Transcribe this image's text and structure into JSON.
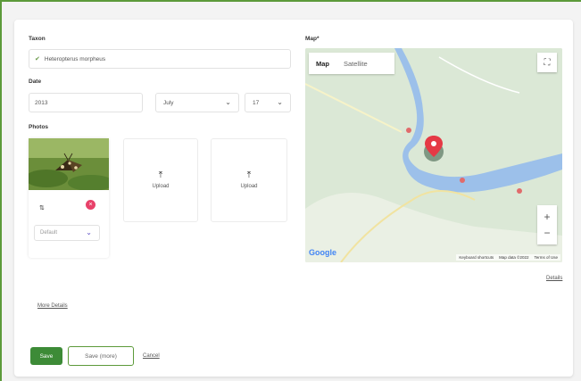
{
  "form": {
    "taxon_label": "Taxon",
    "taxon_value": "Heteropterus morpheus",
    "date_label": "Date",
    "year": "2013",
    "month": "July",
    "day": "17",
    "photos_label": "Photos",
    "upload_label_1": "Upload",
    "upload_label_2": "Upload",
    "photo_select": "Default",
    "photo_tag": "⇅",
    "more_details": "More Details",
    "buttons": {
      "save": "Save",
      "save_more": "Save (more)",
      "cancel": "Cancel"
    }
  },
  "map": {
    "label": "Map*",
    "tab_map": "Map",
    "tab_satellite": "Satellite",
    "attribution_shortcuts": "Keyboard shortcuts",
    "attribution_data": "Map data ©2022",
    "attribution_terms": "Terms of Use",
    "details_link": "Details",
    "google": "Google",
    "colors": {
      "water": "#9cc0ea",
      "land": "#dbe8d6",
      "marker": "#e53945",
      "marker_halo": "#4a4a4a"
    }
  }
}
